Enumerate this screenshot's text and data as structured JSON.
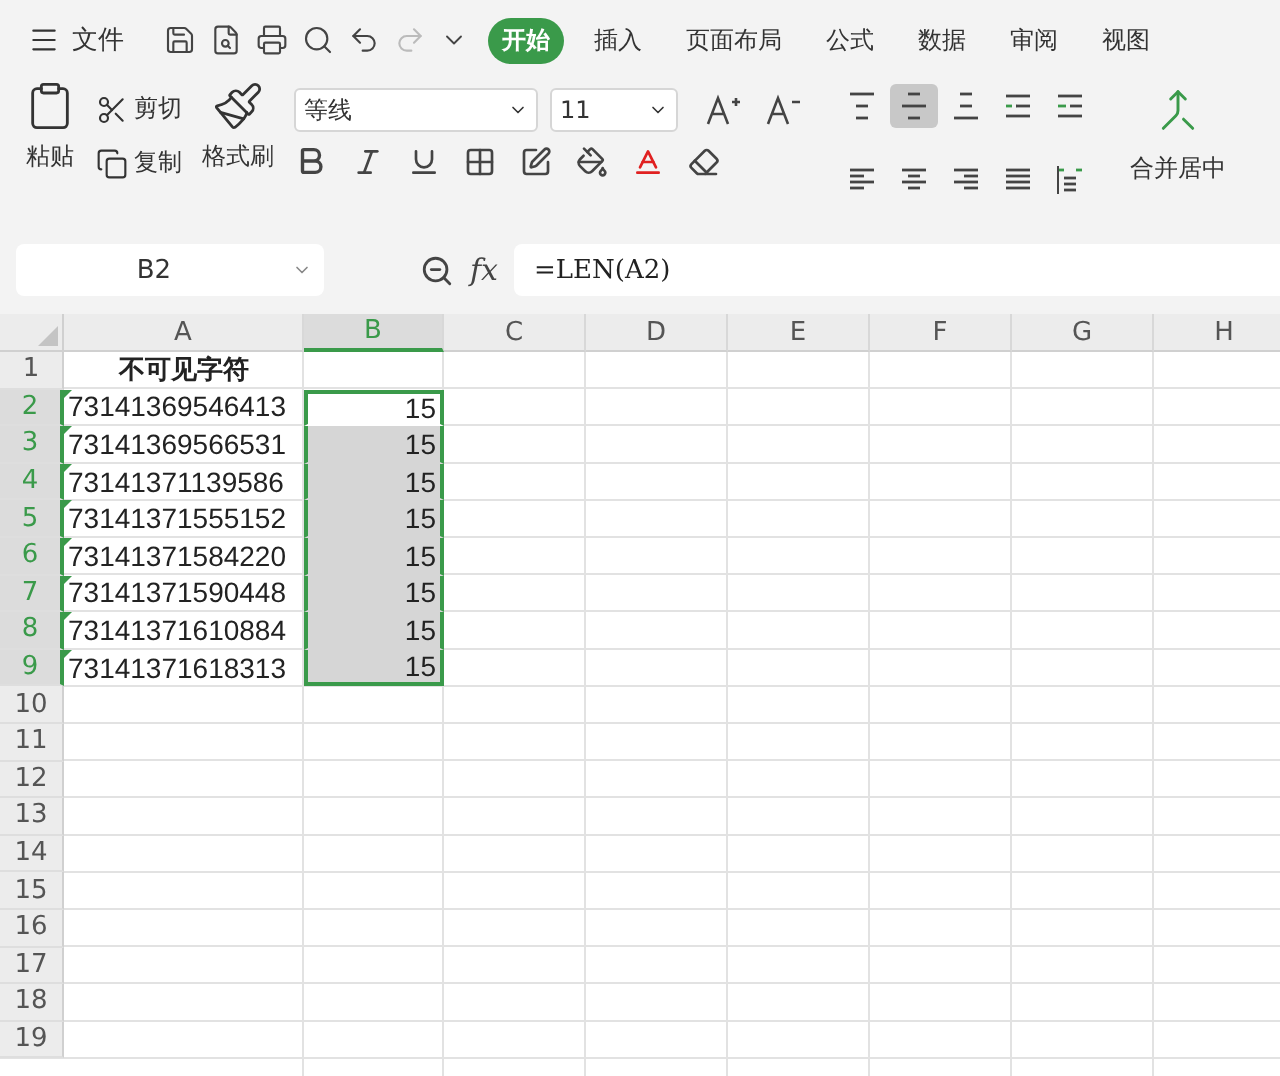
{
  "menu": {
    "label": "文件"
  },
  "tabs": [
    {
      "label": "开始",
      "selected": true
    },
    {
      "label": "插入",
      "selected": false
    },
    {
      "label": "页面布局",
      "selected": false
    },
    {
      "label": "公式",
      "selected": false
    },
    {
      "label": "数据",
      "selected": false
    },
    {
      "label": "审阅",
      "selected": false
    },
    {
      "label": "视图",
      "selected": false
    }
  ],
  "clipboard": {
    "paste": "粘贴",
    "cut": "剪切",
    "copy": "复制",
    "format_painter": "格式刷"
  },
  "font": {
    "name": "等线",
    "size": "11"
  },
  "alignment": [
    {
      "kind": "top",
      "selected": false
    },
    {
      "kind": "middle",
      "selected": true
    },
    {
      "kind": "bottom",
      "selected": false
    },
    {
      "kind": "outdent",
      "selected": false
    },
    {
      "kind": "indent",
      "selected": false
    },
    {
      "kind": "left",
      "selected": false
    },
    {
      "kind": "center",
      "selected": false
    },
    {
      "kind": "right",
      "selected": false
    },
    {
      "kind": "justify",
      "selected": false
    },
    {
      "kind": "distributed",
      "selected": false
    }
  ],
  "merge": {
    "label": "合并居中"
  },
  "formula_bar": {
    "name_box": "B2",
    "fx_label": "fx",
    "formula": "=LEN(A2)"
  },
  "columns": [
    {
      "label": "A",
      "selected": false
    },
    {
      "label": "B",
      "selected": true
    },
    {
      "label": "C",
      "selected": false
    },
    {
      "label": "D",
      "selected": false
    },
    {
      "label": "E",
      "selected": false
    },
    {
      "label": "F",
      "selected": false
    },
    {
      "label": "G",
      "selected": false
    },
    {
      "label": "H",
      "selected": false
    }
  ],
  "rows": [
    {
      "number": "1",
      "selected": false,
      "kind": "header",
      "cells": [
        {
          "text": "不可见字符",
          "marked": false
        }
      ]
    },
    {
      "number": "2",
      "selected": true,
      "kind": "data",
      "cells": [
        {
          "text": "73141369546413",
          "marked": true
        },
        {
          "text": "15",
          "active": true
        }
      ]
    },
    {
      "number": "3",
      "selected": true,
      "kind": "data",
      "cells": [
        {
          "text": "73141369566531",
          "marked": true
        },
        {
          "text": "15",
          "active": false
        }
      ]
    },
    {
      "number": "4",
      "selected": true,
      "kind": "data",
      "cells": [
        {
          "text": "73141371139586",
          "marked": true
        },
        {
          "text": "15",
          "active": false
        }
      ]
    },
    {
      "number": "5",
      "selected": true,
      "kind": "data",
      "cells": [
        {
          "text": "73141371555152",
          "marked": true
        },
        {
          "text": "15",
          "active": false
        }
      ]
    },
    {
      "number": "6",
      "selected": true,
      "kind": "data",
      "cells": [
        {
          "text": "73141371584220",
          "marked": true
        },
        {
          "text": "15",
          "active": false
        }
      ]
    },
    {
      "number": "7",
      "selected": true,
      "kind": "data",
      "cells": [
        {
          "text": "73141371590448",
          "marked": true
        },
        {
          "text": "15",
          "active": false
        }
      ]
    },
    {
      "number": "8",
      "selected": true,
      "kind": "data",
      "cells": [
        {
          "text": "73141371610884",
          "marked": true
        },
        {
          "text": "15",
          "active": false
        }
      ]
    },
    {
      "number": "9",
      "selected": true,
      "kind": "data",
      "cells": [
        {
          "text": "73141371618313",
          "marked": true
        },
        {
          "text": "15",
          "active": false
        }
      ]
    },
    {
      "number": "10",
      "selected": false
    },
    {
      "number": "11",
      "selected": false
    },
    {
      "number": "12",
      "selected": false
    },
    {
      "number": "13",
      "selected": false
    },
    {
      "number": "14",
      "selected": false
    },
    {
      "number": "15",
      "selected": false
    },
    {
      "number": "16",
      "selected": false
    },
    {
      "number": "17",
      "selected": false
    },
    {
      "number": "18",
      "selected": false
    },
    {
      "number": "19",
      "selected": false
    }
  ]
}
